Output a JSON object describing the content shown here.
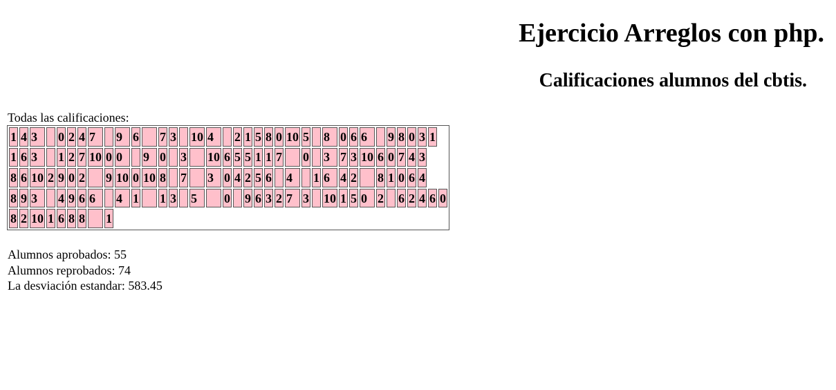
{
  "title": "Ejercicio Arreglos con php.",
  "subtitle": "Calificaciones alumnos del cbtis.",
  "all_grades_label": "Todas las calificaciones:",
  "grade_rows": [
    [
      "1",
      "4",
      "3",
      "",
      "0",
      "2",
      "4",
      "7",
      "",
      "9",
      "6",
      "",
      "7",
      "3",
      "",
      "10",
      "4",
      "",
      "2",
      "1",
      "5",
      "8",
      "0",
      "10",
      "5",
      "",
      "8",
      "0",
      "6",
      "6",
      "",
      "9",
      "8",
      "0",
      "3",
      "1"
    ],
    [
      "1",
      "6",
      "3",
      "",
      "1",
      "2",
      "7",
      "10",
      "0",
      "0",
      "",
      "9",
      "0",
      "",
      "3",
      "",
      "10",
      "6",
      "5",
      "5",
      "1",
      "1",
      "7",
      "",
      "0",
      "",
      "3",
      "7",
      "3",
      "10",
      "6",
      "0",
      "7",
      "4",
      "3"
    ],
    [
      "8",
      "6",
      "10",
      "2",
      "9",
      "0",
      "2",
      "",
      "9",
      "10",
      "0",
      "10",
      "8",
      "",
      "7",
      "",
      "3",
      "0",
      "4",
      "2",
      "5",
      "6",
      "",
      "4",
      "",
      "1",
      "6",
      "4",
      "2",
      "",
      "8",
      "1",
      "0",
      "6",
      "4"
    ],
    [
      "8",
      "9",
      "3",
      "",
      "4",
      "9",
      "6",
      "6",
      "",
      "4",
      "1",
      "",
      "1",
      "3",
      "",
      "5",
      "",
      "0",
      "",
      "9",
      "6",
      "3",
      "2",
      "7",
      "3",
      "",
      "10",
      "1",
      "5",
      "0",
      "2",
      "",
      "6",
      "2",
      "4",
      "6",
      "0"
    ],
    [
      "8",
      "2",
      "10",
      "1",
      "6",
      "8",
      "8",
      "",
      "1"
    ]
  ],
  "stats": {
    "approved": "Alumnos aprobados: 55",
    "failed": "Alumnos reprobados: 74",
    "std_dev": "La desviación estandar: 583.45"
  }
}
